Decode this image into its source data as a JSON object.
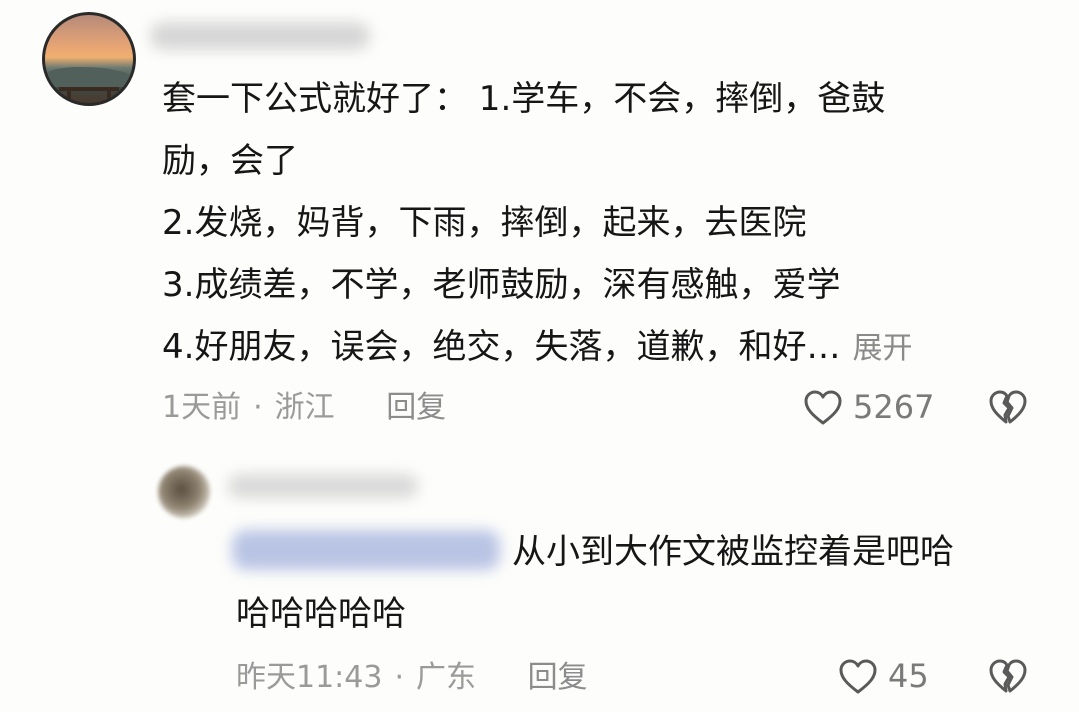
{
  "comment": {
    "lines": [
      "套一下公式就好了： 1.学车，不会，摔倒，爸鼓",
      "励，会了",
      "2.发烧，妈背，下雨，摔倒，起来，去医院",
      "3.成绩差，不学，老师鼓励，深有感触，爱学",
      "4.好朋友，误会，绝交，失落，道歉，和好…"
    ],
    "expand_label": "展开",
    "time": "1天前",
    "separator": "·",
    "location": "浙江",
    "reply_label": "回复",
    "like_count": "5267"
  },
  "reply": {
    "lines": [
      "从小到大作文被监控着是吧哈",
      "哈哈哈哈哈"
    ],
    "time": "昨天11:43",
    "separator": "·",
    "location": "广东",
    "reply_label": "回复",
    "like_count": "45"
  },
  "icons": {
    "like": "heart-outline-icon",
    "dislike": "broken-heart-icon"
  },
  "colors": {
    "text": "#161616",
    "meta": "#9a9a9a",
    "background": "#fdfdfb"
  }
}
